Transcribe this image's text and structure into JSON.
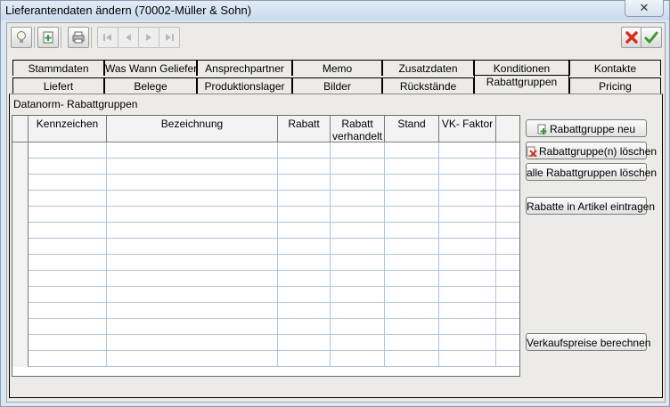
{
  "window": {
    "title": "Lieferantendaten ändern (70002-Müller & Sohn)",
    "close_label": "✕"
  },
  "toolbar": {
    "icons": [
      "lightbulb-icon",
      "add-document-icon",
      "print-icon",
      "first-record-icon",
      "previous-record-icon",
      "next-record-icon",
      "last-record-icon",
      "cancel-icon",
      "confirm-icon"
    ],
    "colors": {
      "cancel": "#d8301c",
      "confirm": "#3a9a2a"
    }
  },
  "tabs": {
    "row1": [
      "Stammdaten",
      "Was Wann Geliefert",
      "Ansprechpartner",
      "Memo",
      "Zusatzdaten",
      "Konditionen",
      "Kontakte"
    ],
    "row2": [
      "Liefert",
      "Belege",
      "Produktionslager",
      "Bilder",
      "Rückstände",
      "Rabattgruppen",
      "Pricing"
    ],
    "active": "Rabattgruppen"
  },
  "panel": {
    "grid_label": "Datanorm- Rabattgruppen",
    "columns": [
      "Kennzeichen",
      "Bezeichnung",
      "Rabatt",
      "Rabatt verhandelt",
      "Stand",
      "VK- Faktor"
    ],
    "rows": []
  },
  "buttons": {
    "new_group": "Rabattgruppe neu",
    "delete_groups": "Rabattgruppe(n) löschen",
    "delete_all": "alle Rabattgruppen löschen",
    "apply_discounts": "Rabatte in Artikel eintragen",
    "calc_prices": "Verkaufspreise berechnen"
  },
  "colors": {
    "title_bg": "#c9d9ee",
    "window_bg": "#ecebe8",
    "grid_line": "#aec4de"
  }
}
